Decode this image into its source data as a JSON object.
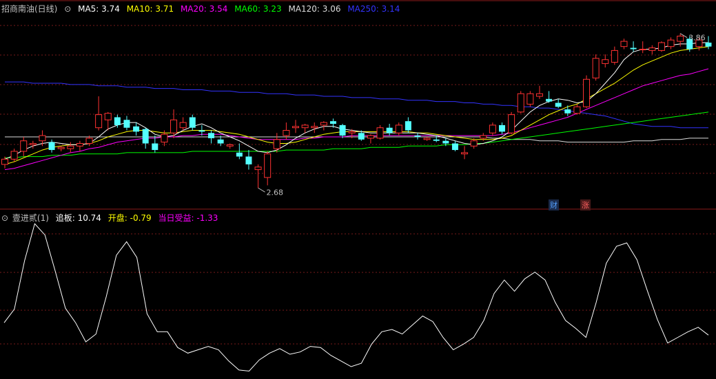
{
  "main_header": {
    "title": "招商南油(日线)",
    "ma": [
      {
        "label": "MA5: 3.74",
        "color": "#ffffff"
      },
      {
        "label": "MA10: 3.71",
        "color": "#ffff00"
      },
      {
        "label": "MA20: 3.54",
        "color": "#ff00ff"
      },
      {
        "label": "MA60: 3.23",
        "color": "#00ff00"
      },
      {
        "label": "MA120: 3.06",
        "color": "#dddddd"
      },
      {
        "label": "MA250: 3.14",
        "color": "#3333ff"
      }
    ]
  },
  "indicator_header": {
    "name": "壹进贰(1)",
    "items": [
      {
        "label": "追板: 10.74",
        "color": "#ffffff"
      },
      {
        "label": "开盘: -0.79",
        "color": "#ffff00"
      },
      {
        "label": "当日受益: -1.33",
        "color": "#ff00ff"
      }
    ]
  },
  "markers": {
    "cai": "财",
    "zhang": "涨"
  },
  "chart_data": [
    {
      "type": "candlestick",
      "title": "招商南油(日线)",
      "ylim": [
        2.55,
        4.0
      ],
      "annotations": {
        "high": "3.86",
        "low": "2.68",
        "high_value": 3.86,
        "low_value": 2.68
      },
      "colors": {
        "up": "#ff3232",
        "down": "#54ffff",
        "ma5": "#ffffff",
        "ma10": "#ffff00",
        "ma20": "#ff00ff",
        "ma60": "#00ff00",
        "ma120": "#dddddd",
        "ma250": "#3333ff"
      },
      "ohlc": [
        [
          2.86,
          2.92,
          2.83,
          2.9
        ],
        [
          2.9,
          2.98,
          2.88,
          2.96
        ],
        [
          2.96,
          3.07,
          2.92,
          3.04
        ],
        [
          3.01,
          3.04,
          2.98,
          3.02
        ],
        [
          3.04,
          3.12,
          3.0,
          3.08
        ],
        [
          3.03,
          3.05,
          2.95,
          2.97
        ],
        [
          2.98,
          3.0,
          2.96,
          2.99
        ],
        [
          2.98,
          3.03,
          2.95,
          3.0
        ],
        [
          3.0,
          3.04,
          2.96,
          3.02
        ],
        [
          3.02,
          3.08,
          3.0,
          3.06
        ],
        [
          3.14,
          3.38,
          3.12,
          3.24
        ],
        [
          3.2,
          3.26,
          3.12,
          3.25
        ],
        [
          3.22,
          3.24,
          3.14,
          3.16
        ],
        [
          3.2,
          3.23,
          3.12,
          3.14
        ],
        [
          3.15,
          3.18,
          3.08,
          3.11
        ],
        [
          3.13,
          3.14,
          2.98,
          3.02
        ],
        [
          3.02,
          3.08,
          2.95,
          2.97
        ],
        [
          3.03,
          3.12,
          3.0,
          3.09
        ],
        [
          3.1,
          3.28,
          3.06,
          3.2
        ],
        [
          3.14,
          3.22,
          3.12,
          3.18
        ],
        [
          3.22,
          3.24,
          3.12,
          3.14
        ],
        [
          3.12,
          3.16,
          3.08,
          3.11
        ],
        [
          3.1,
          3.12,
          3.02,
          3.06
        ],
        [
          3.05,
          3.08,
          3.0,
          3.02
        ],
        [
          3.0,
          3.02,
          2.98,
          3.01
        ],
        [
          2.95,
          3.02,
          2.9,
          2.92
        ],
        [
          2.92,
          2.97,
          2.82,
          2.86
        ],
        [
          2.82,
          2.86,
          2.68,
          2.84
        ],
        [
          2.76,
          2.96,
          2.7,
          2.94
        ],
        [
          2.98,
          3.1,
          2.95,
          3.05
        ],
        [
          3.08,
          3.18,
          3.05,
          3.12
        ],
        [
          3.14,
          3.2,
          3.1,
          3.15
        ],
        [
          3.14,
          3.17,
          3.1,
          3.16
        ],
        [
          3.14,
          3.18,
          3.1,
          3.15
        ],
        [
          3.16,
          3.19,
          3.12,
          3.18
        ],
        [
          3.19,
          3.21,
          3.14,
          3.17
        ],
        [
          3.16,
          3.17,
          3.06,
          3.08
        ],
        [
          3.1,
          3.13,
          3.06,
          3.11
        ],
        [
          3.1,
          3.12,
          3.04,
          3.05
        ],
        [
          3.06,
          3.09,
          3.02,
          3.08
        ],
        [
          3.06,
          3.16,
          3.05,
          3.14
        ],
        [
          3.14,
          3.17,
          3.08,
          3.1
        ],
        [
          3.1,
          3.18,
          3.08,
          3.16
        ],
        [
          3.19,
          3.22,
          3.1,
          3.12
        ],
        [
          3.08,
          3.1,
          3.05,
          3.07
        ],
        [
          3.05,
          3.07,
          3.04,
          3.06
        ],
        [
          3.05,
          3.08,
          3.03,
          3.04
        ],
        [
          3.04,
          3.06,
          3.0,
          3.02
        ],
        [
          3.02,
          3.04,
          2.96,
          2.97
        ],
        [
          2.94,
          3.0,
          2.9,
          2.95
        ],
        [
          3.0,
          3.06,
          2.98,
          3.04
        ],
        [
          3.06,
          3.1,
          3.04,
          3.08
        ],
        [
          3.1,
          3.18,
          3.08,
          3.16
        ],
        [
          3.16,
          3.18,
          3.09,
          3.11
        ],
        [
          3.1,
          3.26,
          3.09,
          3.24
        ],
        [
          3.26,
          3.42,
          3.25,
          3.4
        ],
        [
          3.32,
          3.42,
          3.3,
          3.4
        ],
        [
          3.38,
          3.46,
          3.36,
          3.4
        ],
        [
          3.36,
          3.42,
          3.33,
          3.34
        ],
        [
          3.33,
          3.36,
          3.29,
          3.3
        ],
        [
          3.28,
          3.31,
          3.23,
          3.25
        ],
        [
          3.25,
          3.32,
          3.24,
          3.3
        ],
        [
          3.3,
          3.54,
          3.29,
          3.51
        ],
        [
          3.52,
          3.7,
          3.5,
          3.67
        ],
        [
          3.63,
          3.7,
          3.6,
          3.66
        ],
        [
          3.64,
          3.76,
          3.62,
          3.73
        ],
        [
          3.76,
          3.82,
          3.74,
          3.8
        ],
        [
          3.75,
          3.8,
          3.72,
          3.74
        ],
        [
          3.74,
          3.8,
          3.71,
          3.74
        ],
        [
          3.73,
          3.77,
          3.7,
          3.75
        ],
        [
          3.73,
          3.8,
          3.72,
          3.79
        ],
        [
          3.76,
          3.83,
          3.74,
          3.81
        ],
        [
          3.8,
          3.86,
          3.76,
          3.84
        ],
        [
          3.82,
          3.84,
          3.72,
          3.74
        ],
        [
          3.76,
          3.83,
          3.73,
          3.81
        ],
        [
          3.79,
          3.84,
          3.74,
          3.76
        ]
      ],
      "ma_lines": {
        "ma5": [
          2.9,
          2.93,
          2.97,
          3.0,
          3.02,
          3.03,
          3.02,
          3.01,
          3.01,
          3.02,
          3.07,
          3.13,
          3.16,
          3.18,
          3.18,
          3.14,
          3.09,
          3.07,
          3.08,
          3.12,
          3.15,
          3.17,
          3.14,
          3.1,
          3.07,
          3.04,
          3.0,
          2.96,
          2.95,
          2.97,
          3.01,
          3.06,
          3.1,
          3.13,
          3.15,
          3.15,
          3.13,
          3.12,
          3.11,
          3.1,
          3.1,
          3.1,
          3.1,
          3.1,
          3.1,
          3.09,
          3.08,
          3.06,
          3.04,
          3.02,
          3.01,
          3.02,
          3.04,
          3.07,
          3.12,
          3.19,
          3.26,
          3.31,
          3.34,
          3.36,
          3.35,
          3.33,
          3.34,
          3.4,
          3.48,
          3.56,
          3.66,
          3.72,
          3.74,
          3.74,
          3.75,
          3.77,
          3.78,
          3.78,
          3.79,
          3.79
        ],
        "ma10": [
          2.86,
          2.88,
          2.91,
          2.94,
          2.97,
          2.99,
          3.0,
          3.01,
          3.01,
          3.02,
          3.04,
          3.07,
          3.09,
          3.11,
          3.12,
          3.12,
          3.11,
          3.1,
          3.1,
          3.11,
          3.12,
          3.12,
          3.12,
          3.11,
          3.1,
          3.09,
          3.07,
          3.05,
          3.03,
          3.02,
          3.02,
          3.03,
          3.05,
          3.07,
          3.09,
          3.1,
          3.11,
          3.11,
          3.11,
          3.11,
          3.11,
          3.11,
          3.11,
          3.11,
          3.1,
          3.1,
          3.09,
          3.08,
          3.07,
          3.06,
          3.05,
          3.05,
          3.05,
          3.06,
          3.08,
          3.12,
          3.16,
          3.2,
          3.24,
          3.27,
          3.3,
          3.32,
          3.36,
          3.4,
          3.44,
          3.48,
          3.53,
          3.58,
          3.62,
          3.65,
          3.68,
          3.71,
          3.73,
          3.74,
          3.75,
          3.76
        ],
        "ma20": [
          2.82,
          2.83,
          2.85,
          2.87,
          2.89,
          2.91,
          2.93,
          2.95,
          2.96,
          2.98,
          2.99,
          3.01,
          3.03,
          3.04,
          3.05,
          3.06,
          3.06,
          3.07,
          3.07,
          3.08,
          3.08,
          3.09,
          3.09,
          3.09,
          3.08,
          3.07,
          3.06,
          3.05,
          3.05,
          3.05,
          3.05,
          3.05,
          3.06,
          3.06,
          3.07,
          3.07,
          3.07,
          3.08,
          3.08,
          3.08,
          3.08,
          3.08,
          3.08,
          3.08,
          3.08,
          3.08,
          3.08,
          3.08,
          3.08,
          3.08,
          3.08,
          3.08,
          3.08,
          3.09,
          3.1,
          3.12,
          3.14,
          3.16,
          3.18,
          3.2,
          3.22,
          3.25,
          3.28,
          3.31,
          3.34,
          3.37,
          3.4,
          3.43,
          3.46,
          3.48,
          3.5,
          3.52,
          3.54,
          3.55,
          3.57,
          3.59
        ],
        "ma60": [
          2.91,
          2.91,
          2.92,
          2.92,
          2.92,
          2.93,
          2.93,
          2.93,
          2.94,
          2.94,
          2.94,
          2.94,
          2.94,
          2.95,
          2.95,
          2.95,
          2.95,
          2.95,
          2.95,
          2.95,
          2.96,
          2.96,
          2.96,
          2.96,
          2.96,
          2.96,
          2.96,
          2.96,
          2.96,
          2.96,
          2.97,
          2.97,
          2.97,
          2.97,
          2.97,
          2.98,
          2.98,
          2.98,
          2.98,
          2.99,
          2.99,
          2.99,
          2.99,
          3.0,
          3.0,
          3.0,
          3.0,
          3.01,
          3.01,
          3.01,
          3.02,
          3.02,
          3.03,
          3.04,
          3.05,
          3.06,
          3.07,
          3.08,
          3.09,
          3.1,
          3.11,
          3.12,
          3.13,
          3.14,
          3.15,
          3.16,
          3.17,
          3.18,
          3.19,
          3.2,
          3.21,
          3.22,
          3.23,
          3.24,
          3.25,
          3.26
        ],
        "ma120": [
          3.07,
          3.07,
          3.07,
          3.07,
          3.07,
          3.07,
          3.07,
          3.07,
          3.07,
          3.07,
          3.07,
          3.07,
          3.07,
          3.07,
          3.07,
          3.07,
          3.07,
          3.07,
          3.07,
          3.07,
          3.07,
          3.07,
          3.07,
          3.07,
          3.07,
          3.07,
          3.07,
          3.07,
          3.07,
          3.07,
          3.07,
          3.07,
          3.07,
          3.07,
          3.07,
          3.07,
          3.07,
          3.07,
          3.07,
          3.07,
          3.07,
          3.07,
          3.07,
          3.07,
          3.07,
          3.07,
          3.07,
          3.07,
          3.07,
          3.07,
          3.07,
          3.07,
          3.06,
          3.06,
          3.05,
          3.05,
          3.05,
          3.04,
          3.04,
          3.04,
          3.03,
          3.03,
          3.03,
          3.03,
          3.03,
          3.03,
          3.03,
          3.04,
          3.04,
          3.04,
          3.05,
          3.05,
          3.05,
          3.06,
          3.06,
          3.06
        ],
        "ma250": [
          3.49,
          3.49,
          3.49,
          3.48,
          3.48,
          3.48,
          3.48,
          3.47,
          3.47,
          3.47,
          3.46,
          3.46,
          3.46,
          3.45,
          3.45,
          3.45,
          3.44,
          3.44,
          3.44,
          3.43,
          3.43,
          3.43,
          3.42,
          3.42,
          3.42,
          3.41,
          3.41,
          3.41,
          3.4,
          3.4,
          3.4,
          3.39,
          3.39,
          3.39,
          3.38,
          3.38,
          3.38,
          3.37,
          3.37,
          3.37,
          3.36,
          3.36,
          3.36,
          3.35,
          3.35,
          3.35,
          3.34,
          3.34,
          3.34,
          3.33,
          3.33,
          3.32,
          3.32,
          3.31,
          3.31,
          3.3,
          3.3,
          3.29,
          3.29,
          3.28,
          3.27,
          3.26,
          3.25,
          3.24,
          3.23,
          3.21,
          3.19,
          3.17,
          3.16,
          3.15,
          3.15,
          3.15,
          3.14,
          3.14,
          3.14,
          3.14
        ]
      }
    },
    {
      "type": "line",
      "title": "壹进贰(1)",
      "ylim": [
        -2,
        12
      ],
      "series": [
        {
          "values": [
            3.0,
            4.2,
            8.5,
            11.8,
            10.8,
            7.6,
            4.3,
            3.0,
            1.3,
            2.0,
            5.3,
            9.0,
            10.2,
            8.8,
            3.8,
            2.2,
            2.2,
            0.8,
            0.3,
            0.6,
            0.9,
            0.6,
            -0.4,
            -1.2,
            -1.3,
            -0.3,
            0.3,
            0.7,
            0.2,
            0.4,
            0.9,
            0.8,
            0.1,
            -0.4,
            -0.9,
            -0.6,
            1.1,
            2.2,
            2.4,
            2.0,
            2.8,
            3.6,
            3.1,
            1.7,
            0.6,
            1.1,
            1.7,
            3.2,
            5.6,
            6.8,
            5.8,
            6.9,
            7.5,
            6.8,
            4.8,
            3.2,
            2.5,
            1.7,
            4.8,
            8.3,
            9.8,
            10.1,
            8.6,
            5.9,
            3.3,
            1.2,
            1.7,
            2.2,
            2.6,
            1.9
          ]
        }
      ]
    }
  ]
}
